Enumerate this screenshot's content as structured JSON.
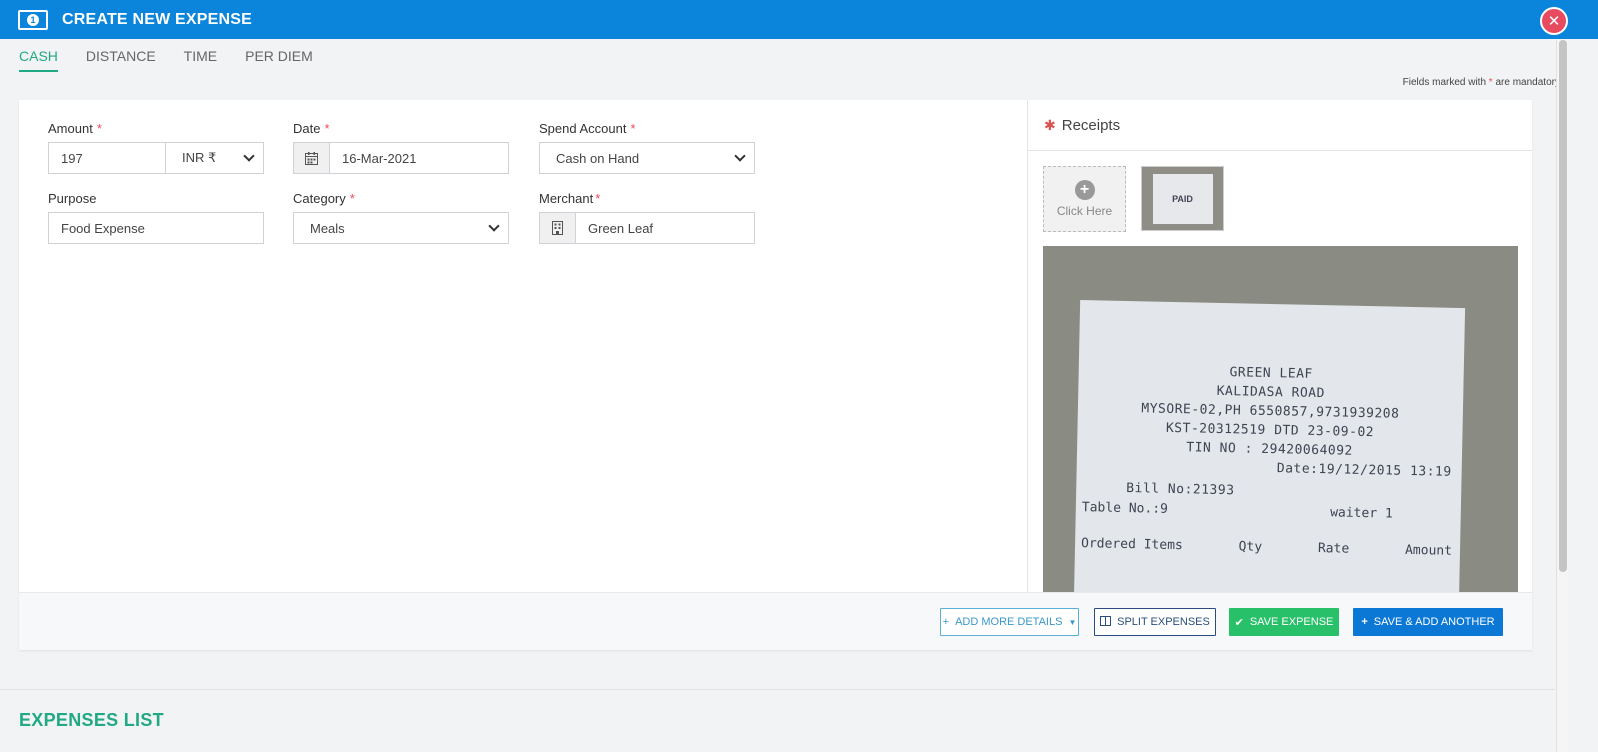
{
  "header": {
    "title": "CREATE NEW EXPENSE",
    "icon": "money-icon",
    "close_icon": "close-icon",
    "color": "#0b84dc"
  },
  "tabs": [
    {
      "label": "CASH",
      "active": true
    },
    {
      "label": "DISTANCE",
      "active": false
    },
    {
      "label": "TIME",
      "active": false
    },
    {
      "label": "PER DIEM",
      "active": false
    }
  ],
  "mandatory_note": {
    "prefix": "Fields marked with",
    "star": "*",
    "suffix": "are mandatory."
  },
  "form": {
    "amount": {
      "label": "Amount",
      "value": "197",
      "currency": "INR ₹"
    },
    "date": {
      "label": "Date",
      "value": "16-Mar-2021"
    },
    "spend_account": {
      "label": "Spend Account",
      "value": "Cash on Hand"
    },
    "purpose": {
      "label": "Purpose",
      "value": "Food Expense"
    },
    "category": {
      "label": "Category",
      "value": "Meals"
    },
    "merchant": {
      "label": "Merchant",
      "value": "Green Leaf"
    },
    "required_mark": "*"
  },
  "receipts": {
    "title": "Receipts",
    "upload_label": "Click Here",
    "thumb_text": "PAID",
    "preview_lines": [
      "GREEN LEAF",
      "KALIDASA ROAD",
      "MYSORE-02,PH 6550857,9731939208",
      "KST-20312519 DTD 23-09-02",
      "TIN NO : 29420064092",
      "Date:19/12/2015 13:19",
      "Bill No:21393",
      "Table No.:9",
      "waiter 1",
      "Ordered Items",
      "Qty",
      "Rate",
      "Amount"
    ]
  },
  "footer": {
    "add_more": "ADD MORE DETAILS",
    "split": "SPLIT EXPENSES",
    "save": "SAVE EXPENSE",
    "save_add": "SAVE & ADD ANOTHER"
  },
  "expenses_list_title": "EXPENSES LIST",
  "colors": {
    "accent": "#21a884",
    "required": "#e84a5f",
    "save": "#28c16a",
    "primary": "#0b78d6"
  }
}
